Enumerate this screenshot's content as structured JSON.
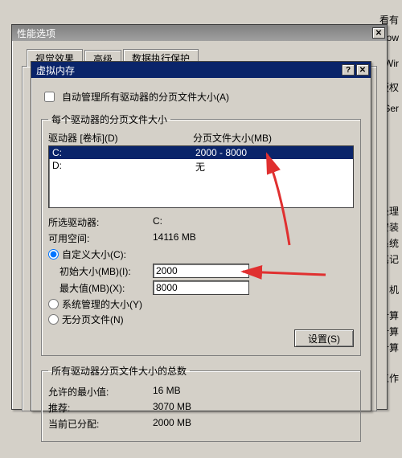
{
  "bg_lines": [
    "看有",
    "low",
    "Wir",
    "版权",
    "Ser",
    "处理",
    "安装",
    "系统",
    "笔记",
    "机",
    "计算",
    "计算",
    "计算",
    "工作"
  ],
  "perf": {
    "title": "性能选项",
    "tabs": {
      "t1": "视觉效果",
      "t2": "高级",
      "t3": "数据执行保护"
    },
    "close": "✕"
  },
  "vm": {
    "title": "虚拟内存",
    "help": "?",
    "close": "✕",
    "auto_manage": "自动管理所有驱动器的分页文件大小(A)",
    "group1": "每个驱动器的分页文件大小",
    "col_drive": "驱动器 [卷标](D)",
    "col_pf": "分页文件大小(MB)",
    "rows": [
      {
        "drive": "C:",
        "pf": "2000 - 8000"
      },
      {
        "drive": "D:",
        "pf": "无"
      }
    ],
    "sel_drive_k": "所选驱动器:",
    "sel_drive_v": "C:",
    "free_k": "可用空间:",
    "free_v": "14116 MB",
    "custom": "自定义大小(C):",
    "init_k": "初始大小(MB)(I):",
    "init_v": "2000",
    "max_k": "最大值(MB)(X):",
    "max_v": "8000",
    "sys_managed": "系统管理的大小(Y)",
    "no_pf": "无分页文件(N)",
    "set_btn": "设置(S)",
    "group2": "所有驱动器分页文件大小的总数",
    "min_k": "允许的最小值:",
    "min_v": "16 MB",
    "rec_k": "推荐:",
    "rec_v": "3070 MB",
    "cur_k": "当前已分配:",
    "cur_v": "2000 MB"
  }
}
